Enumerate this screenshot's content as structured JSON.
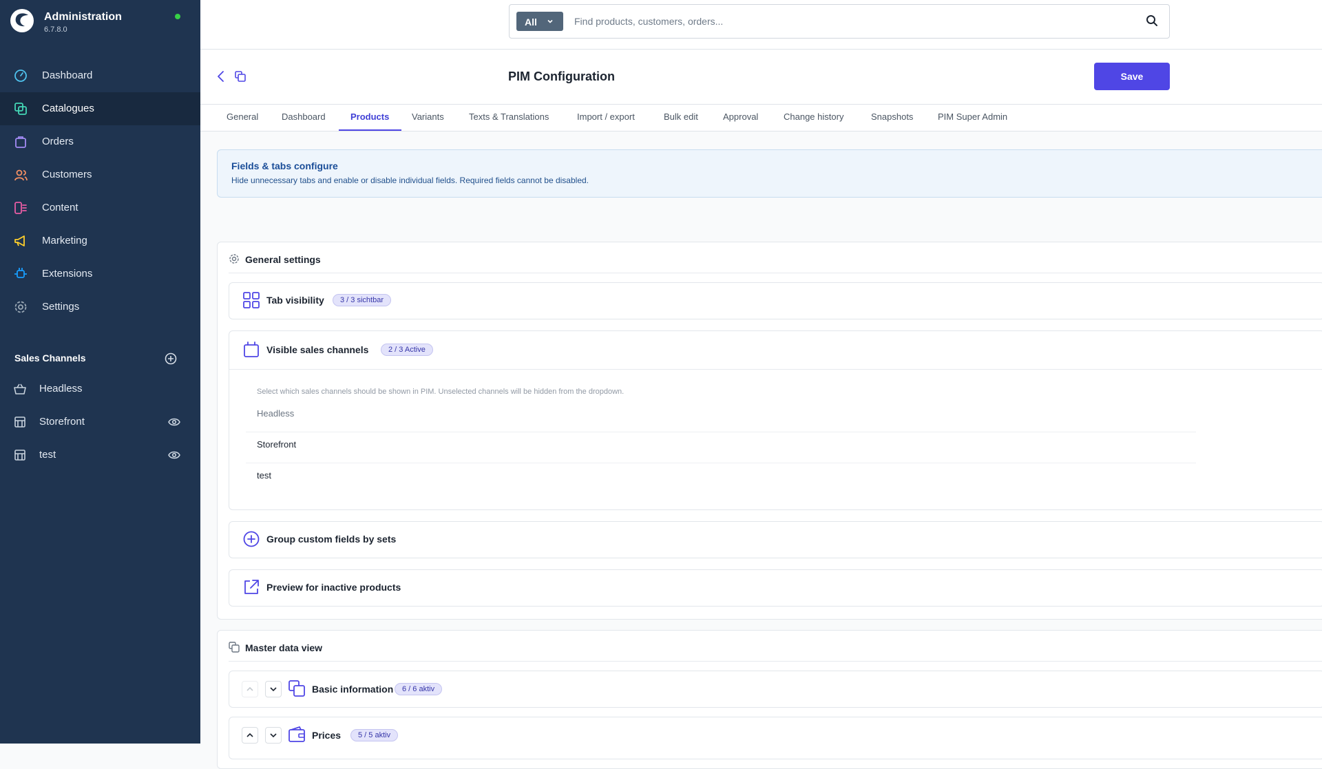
{
  "brand": {
    "title": "Administration",
    "version": "6.7.8.0"
  },
  "nav": [
    {
      "label": "Dashboard",
      "icon": "dashboard-icon",
      "color": "#4fc3ef"
    },
    {
      "label": "Catalogues",
      "icon": "catalogues-icon",
      "color": "#44d7b6",
      "active": true
    },
    {
      "label": "Orders",
      "icon": "orders-icon",
      "color": "#a38bf5"
    },
    {
      "label": "Customers",
      "icon": "customers-icon",
      "color": "#f49063"
    },
    {
      "label": "Content",
      "icon": "content-icon",
      "color": "#e85ca5"
    },
    {
      "label": "Marketing",
      "icon": "marketing-icon",
      "color": "#ffd02b"
    },
    {
      "label": "Extensions",
      "icon": "extensions-icon",
      "color": "#189eff"
    },
    {
      "label": "Settings",
      "icon": "settings-icon",
      "color": "#9aa8b5"
    }
  ],
  "sales_channels": {
    "title": "Sales Channels",
    "items": [
      {
        "label": "Headless",
        "icon": "basket-icon",
        "visible_toggle": false
      },
      {
        "label": "Storefront",
        "icon": "storefront-icon",
        "visible_toggle": true
      },
      {
        "label": "test",
        "icon": "storefront-icon",
        "visible_toggle": true
      }
    ]
  },
  "search": {
    "type_label": "All",
    "placeholder": "Find products, customers, orders..."
  },
  "page": {
    "title": "PIM Configuration",
    "save_label": "Save"
  },
  "tabs": [
    {
      "label": "General"
    },
    {
      "label": "Dashboard"
    },
    {
      "label": "Products",
      "active": true
    },
    {
      "label": "Variants"
    },
    {
      "label": "Texts & Translations"
    },
    {
      "label": "Import / export"
    },
    {
      "label": "Bulk edit"
    },
    {
      "label": "Approval"
    },
    {
      "label": "Change history"
    },
    {
      "label": "Snapshots"
    },
    {
      "label": "PIM Super Admin"
    }
  ],
  "info": {
    "title": "Fields & tabs configure",
    "text": "Hide unnecessary tabs and enable or disable individual fields. Required fields cannot be disabled."
  },
  "general_settings": {
    "title": "General settings",
    "tab_visibility": {
      "label": "Tab visibility",
      "badge": "3 / 3 sichtbar"
    },
    "visible_sales_channels": {
      "label": "Visible sales channels",
      "badge": "2 / 3 Active",
      "help": "Select which sales channels should be shown in PIM. Unselected channels will be hidden from the dropdown.",
      "channels": [
        {
          "label": "Headless",
          "selected": false
        },
        {
          "label": "Storefront",
          "selected": true
        },
        {
          "label": "test",
          "selected": true
        }
      ]
    },
    "group_custom_fields": {
      "label": "Group custom fields by sets"
    },
    "preview_inactive": {
      "label": "Preview for inactive products"
    }
  },
  "master_data": {
    "title": "Master data view",
    "rows": [
      {
        "label": "Basic information",
        "badge": "6 / 6 aktiv"
      },
      {
        "label": "Prices",
        "badge": "5 / 5 aktiv"
      }
    ]
  },
  "colors": {
    "accent": "#4f46e5",
    "sidebar": "#1f3450",
    "sidebar_active": "#18293f",
    "info_bg": "#eef5fc"
  }
}
